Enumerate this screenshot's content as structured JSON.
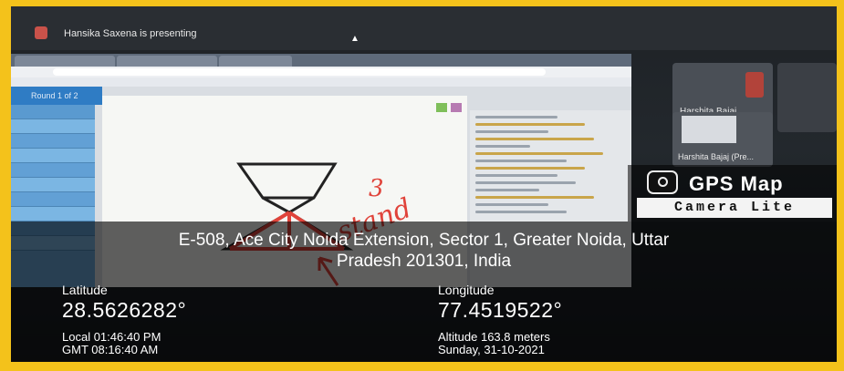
{
  "meet": {
    "presenter_text": "Hansika Saxena is presenting",
    "participants": [
      {
        "name": "Harshita Bajaj"
      },
      {
        "name": "Harshita Bajaj (Pre..."
      }
    ]
  },
  "game": {
    "round_label": "Round 1 of 2",
    "annotation_text": "3 stand"
  },
  "watermark": {
    "title": "GPS Map",
    "subtitle": "Camera Lite"
  },
  "location": {
    "address_line1": "E-508, Ace City Noida Extension, Sector 1, Greater Noida, Uttar",
    "address_line2": "Pradesh 201301, India",
    "latitude_label": "Latitude",
    "latitude_value": "28.5626282°",
    "longitude_label": "Longitude",
    "longitude_value": "77.4519522°",
    "local_time": "Local 01:46:40 PM",
    "gmt_time": "GMT 08:16:40 AM",
    "altitude": "Altitude 163.8 meters",
    "date": "Sunday, 31-10-2021"
  },
  "colors": {
    "border": "#f4c21b",
    "drawing_red": "#e0433a",
    "chart_bg": "#f6f7f4"
  }
}
